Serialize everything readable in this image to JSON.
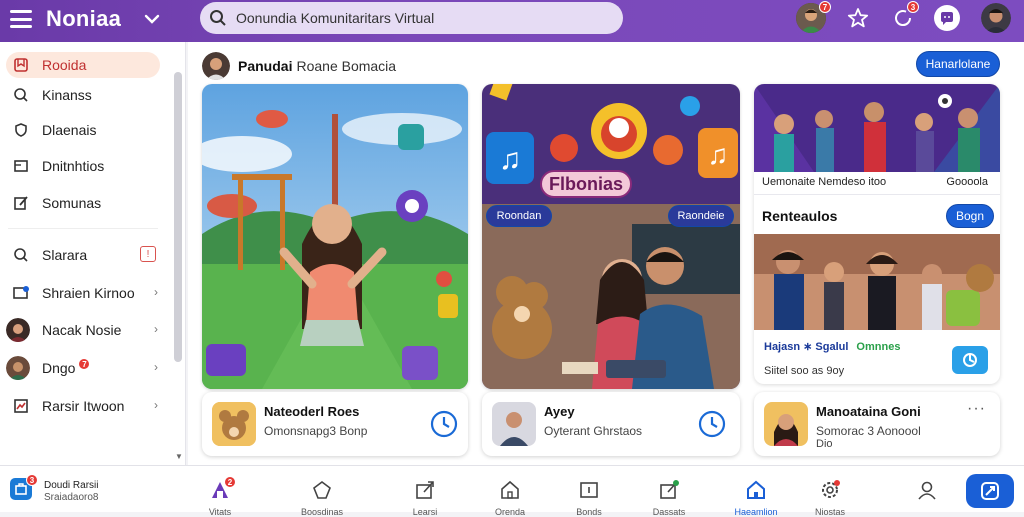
{
  "header": {
    "app_title": "Noniaa",
    "search_value": "Oonundia Komunitaritars Virtual",
    "notif_count": "3",
    "avatar_badge": "7"
  },
  "sidebar": {
    "items": [
      {
        "label": "Rooida",
        "icon": "bookmark-icon",
        "active": true
      },
      {
        "label": "Kinanss",
        "icon": "search-icon"
      },
      {
        "label": "Dlaenais",
        "icon": "shield-icon"
      },
      {
        "label": "Dnitnhtios",
        "icon": "window-icon"
      },
      {
        "label": "Somunas",
        "icon": "edit-icon"
      },
      {
        "label": "Slarara",
        "icon": "search-icon"
      },
      {
        "label": "Shraien Kirnoo",
        "icon": "screen-share-icon"
      },
      {
        "label": "Nacak Nosie",
        "icon": "avatar"
      },
      {
        "label": "Dngo",
        "icon": "avatar",
        "badge": "7"
      },
      {
        "label": "Rarsir Itwoon",
        "icon": "chart-icon"
      }
    ]
  },
  "main": {
    "header_name": "Panudai",
    "header_sub": "Roane Bomacia",
    "top_button": "Hanarlolane",
    "game_card": {
      "title_label": "Flbonias",
      "btn_left": "Roondan",
      "btn_right": "Raondeie"
    },
    "info_cards": [
      {
        "title": "Nateoderl Roes",
        "sub": "Omonsnapg3 Bonp"
      },
      {
        "title": "Ayey",
        "sub": "Oyterant Ghrstaos"
      },
      {
        "title": "Manoataina Goni",
        "sub": "Somorac 3 Aonoool",
        "sub2": "Dio"
      }
    ],
    "right_panel": {
      "caption_left": "Uemonaite Nemdeso itoo",
      "caption_right": "Goooola",
      "section_title": "Renteaulos",
      "section_button": "Bogn",
      "tag_line_1": "Hajasn ∗ Sgalul",
      "tag_line_2": "Omnnes",
      "footer": "Siitel soo as 9oy"
    }
  },
  "bottom_nav": {
    "left_title": "Doudi Rarsii",
    "left_sub": "Sraiadaoro8",
    "left_badge": "3",
    "items": [
      {
        "label": "Vitats",
        "icon": "home-icon",
        "badge": "2"
      },
      {
        "label": "Boosdinas",
        "icon": "diamond-icon"
      },
      {
        "label": "Learsi",
        "icon": "share-icon"
      },
      {
        "label": "Orenda",
        "icon": "house-icon"
      },
      {
        "label": "Bonds",
        "icon": "square-icon"
      },
      {
        "label": "Dassats",
        "icon": "share-icon"
      },
      {
        "label": "Haeamlion",
        "icon": "home-icon"
      },
      {
        "label": "Niostas",
        "icon": "gear-icon"
      },
      {
        "label": "Profile",
        "icon": "user-icon"
      }
    ]
  },
  "colors": {
    "header": "#6a3aa8",
    "accent": "#1a5fd6",
    "active_bg": "#fde8dd"
  }
}
